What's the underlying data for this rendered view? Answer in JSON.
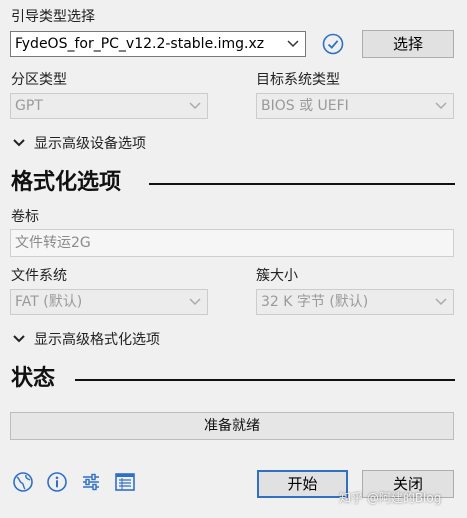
{
  "boot": {
    "label": "引导类型选择",
    "image_value": "FydeOS_for_PC_v12.2-stable.img.xz",
    "select_button": "选择"
  },
  "partition": {
    "label": "分区类型",
    "value": "GPT"
  },
  "target": {
    "label": "目标系统类型",
    "value": "BIOS 或 UEFI"
  },
  "advanced_device": "显示高级设备选项",
  "format": {
    "title": "格式化选项",
    "volume_label": "卷标",
    "volume_value": "文件转运2G",
    "fs_label": "文件系统",
    "fs_value": "FAT (默认)",
    "cluster_label": "簇大小",
    "cluster_value": "32 K 字节 (默认)",
    "advanced_format": "显示高级格式化选项"
  },
  "status": {
    "title": "状态",
    "progress_text": "准备就绪"
  },
  "actions": {
    "start": "开始",
    "close": "关闭"
  },
  "watermark": "知乎 @阿建的Blog",
  "icons": [
    "globe-icon",
    "info-icon",
    "settings-sliders-icon",
    "log-icon",
    "check-circle-icon",
    "chevron-down-icon",
    "expand-triangle-icon"
  ],
  "colors": {
    "accent": "#2f70c5",
    "background": "#f0f0f0"
  }
}
